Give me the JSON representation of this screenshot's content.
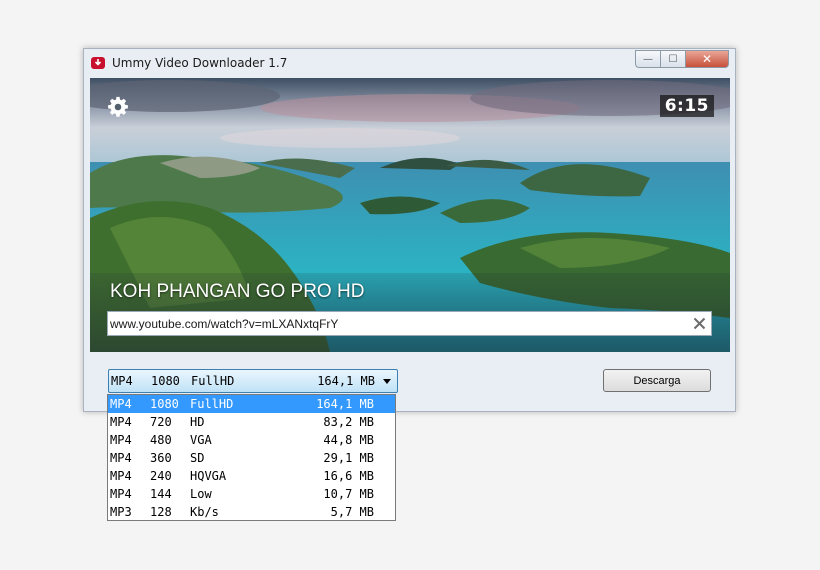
{
  "window": {
    "title": "Ummy Video Downloader 1.7",
    "minimize_glyph": "—",
    "maximize_glyph": "☐",
    "close_glyph": "✕"
  },
  "preview": {
    "duration": "6:15",
    "video_title": "KOH PHANGAN GO PRO HD",
    "url_value": "www.youtube.com/watch?v=mLXANxtqFrY",
    "icons": [
      "gear-icon",
      "close-icon"
    ]
  },
  "format_select": {
    "selected": {
      "format": "MP4",
      "resolution": "1080",
      "quality": "FullHD",
      "size": "164,1 MB"
    }
  },
  "download_button": {
    "label": "Descarga"
  },
  "dropdown": {
    "options": [
      {
        "format": "MP4",
        "resolution": "1080",
        "quality": "FullHD",
        "size": "164,1 MB",
        "selected": true
      },
      {
        "format": "MP4",
        "resolution": "720",
        "quality": "HD",
        "size": "83,2 MB"
      },
      {
        "format": "MP4",
        "resolution": "480",
        "quality": "VGA",
        "size": "44,8 MB"
      },
      {
        "format": "MP4",
        "resolution": "360",
        "quality": "SD",
        "size": "29,1 MB"
      },
      {
        "format": "MP4",
        "resolution": "240",
        "quality": "HQVGA",
        "size": "16,6 MB"
      },
      {
        "format": "MP4",
        "resolution": "144",
        "quality": "Low",
        "size": "10,7 MB"
      },
      {
        "format": "MP3",
        "resolution": "128",
        "quality": "Kb/s",
        "size": "5,7 MB"
      }
    ]
  },
  "colors": {
    "app_icon": "#c8102e",
    "selection": "#3399ff",
    "window_bg": "#e9eef4"
  }
}
